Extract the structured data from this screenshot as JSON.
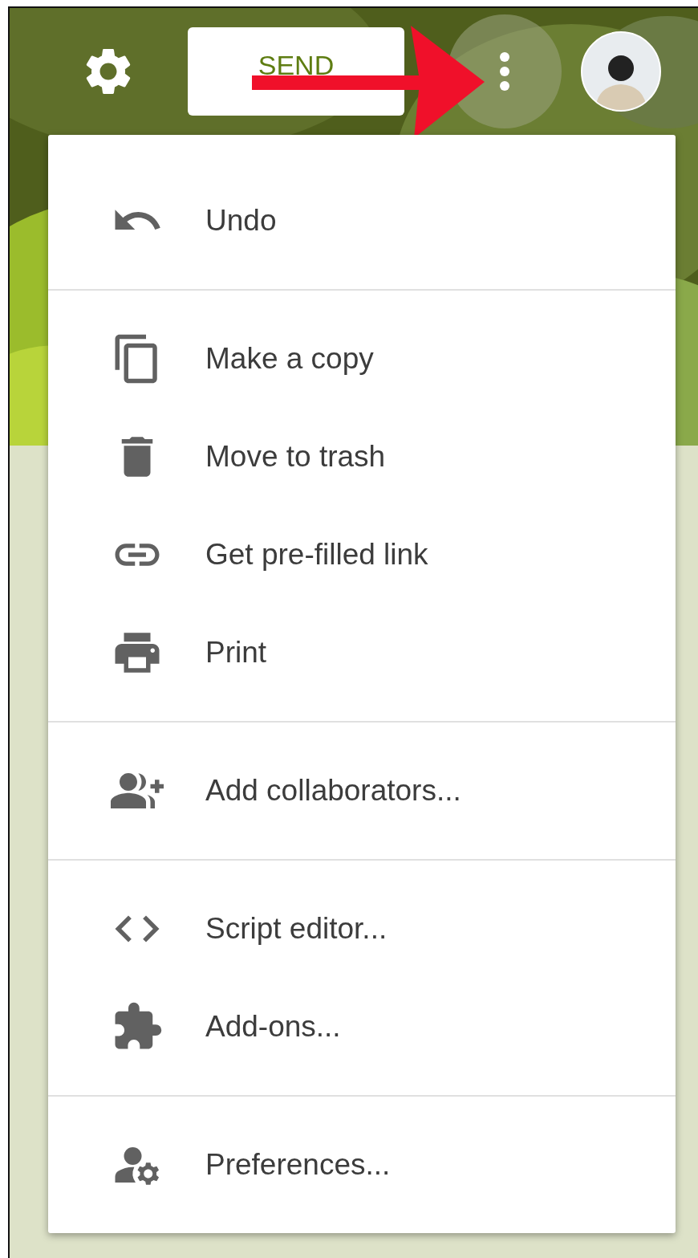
{
  "toolbar": {
    "send_button": "SEND"
  },
  "menu": {
    "sections": [
      [
        {
          "label": "Undo"
        }
      ],
      [
        {
          "label": "Make a copy"
        },
        {
          "label": "Move to trash"
        },
        {
          "label": "Get pre-filled link"
        },
        {
          "label": "Print"
        }
      ],
      [
        {
          "label": "Add collaborators..."
        }
      ],
      [
        {
          "label": "Script editor..."
        },
        {
          "label": "Add-ons..."
        }
      ],
      [
        {
          "label": "Preferences..."
        }
      ]
    ]
  }
}
